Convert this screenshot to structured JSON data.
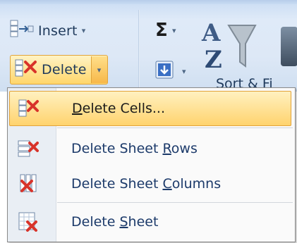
{
  "ribbon": {
    "insert": {
      "label": "Insert",
      "arrow": "▾",
      "icon": "insert-cells-icon"
    },
    "delete": {
      "label": "Delete",
      "arrow": "▾",
      "icon": "delete-cells-icon"
    },
    "autosum": {
      "symbol": "Σ",
      "arrow": "▾"
    },
    "fill": {
      "arrow": "▾",
      "icon": "fill-down-icon"
    },
    "sort_filter": {
      "partial_label": "Sort & Fi",
      "icon": "sort-filter-icon"
    },
    "find": {
      "icon": "find-select-icon"
    }
  },
  "menu": {
    "items": [
      {
        "label_pre": "",
        "accel": "D",
        "label_post": "elete Cells...",
        "icon": "delete-cells-icon",
        "highlighted": true
      },
      {
        "label_pre": "Delete Sheet ",
        "accel": "R",
        "label_post": "ows",
        "icon": "delete-sheet-rows-icon"
      },
      {
        "label_pre": "Delete Sheet ",
        "accel": "C",
        "label_post": "olumns",
        "icon": "delete-sheet-columns-icon"
      },
      {
        "label_pre": "Delete ",
        "accel": "S",
        "label_post": "heet",
        "icon": "delete-sheet-icon"
      }
    ]
  },
  "colors": {
    "ribbon_bg": "#dfeaf8",
    "highlight": "#ffd36e",
    "highlight_border": "#e2a33a",
    "menu_text": "#1c3a6a",
    "delete_red": "#d8332a"
  }
}
